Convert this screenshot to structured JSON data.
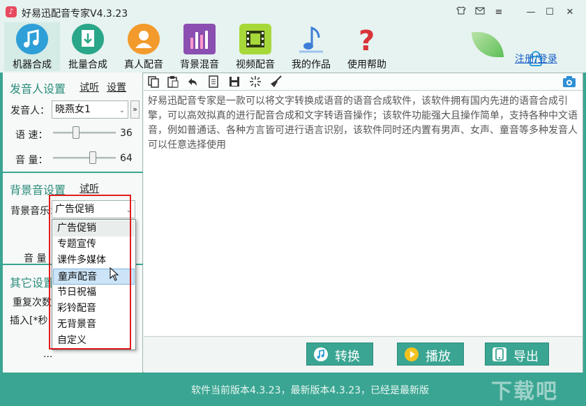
{
  "window": {
    "title": "好易迅配音专家V4.3.23",
    "controls": [
      "shirt-icon",
      "mail-icon",
      "menu-icon",
      "minimize-icon",
      "maximize-icon",
      "close-icon"
    ]
  },
  "toolbar": {
    "items": [
      {
        "label": "机器合成",
        "icon": "music-note-icon",
        "color": "#2f9fd8",
        "active": true
      },
      {
        "label": "批量合成",
        "icon": "download-doc-icon",
        "color": "#2aa688"
      },
      {
        "label": "真人配音",
        "icon": "person-icon",
        "color": "#f39a2c"
      },
      {
        "label": "背景混音",
        "icon": "equalizer-icon",
        "color": "#8a4fb0"
      },
      {
        "label": "视频配音",
        "icon": "film-icon",
        "color": "#a7d83a"
      },
      {
        "label": "我的作品",
        "icon": "music-note-blue-icon",
        "color": "#3d7fd6"
      },
      {
        "label": "使用帮助",
        "icon": "question-icon",
        "color": "#d9333a"
      }
    ],
    "register_label": "注册/登录"
  },
  "speaker_settings": {
    "title": "发音人设置",
    "listen_label": "试听",
    "settings_label": "设置",
    "speaker_label": "发音人：",
    "speaker_value": "晓燕女1",
    "speed_label": "语 速：",
    "speed_value": "36",
    "speed_fraction": 0.36,
    "volume_label": "音 量：",
    "volume_value": "64",
    "volume_fraction": 0.64
  },
  "bg_settings": {
    "title": "背景音设置",
    "listen_label": "试听",
    "music_label": "背景音乐：",
    "music_value": "广告促销",
    "volume_label": "音 量",
    "options": [
      "广告促销",
      "专题宣传",
      "课件多媒体",
      "童声配音",
      "节日祝福",
      "彩铃配音",
      "无背景音",
      "自定义"
    ],
    "hovered_option": "童声配音"
  },
  "other_settings": {
    "title": "其它设置",
    "repeat_label": "重复次数",
    "insert_label": "插入[*秒",
    "ellipsis": "..."
  },
  "editor": {
    "text": "好易迅配音专家是一款可以将文字转换成语音的语音合成软件，该软件拥有国内先进的语音合成引擎，可以高效拟真的进行配音合成和文字转语音操作；该软件功能强大且操作简单，支持各种中文语音，例如普通话、各种方言皆可进行语言识别，该软件同时还内置有男声、女声、童音等多种发音人可以任意选择使用"
  },
  "actions": {
    "convert_label": "转换",
    "play_label": "播放",
    "export_label": "导出"
  },
  "status": {
    "text": "软件当前版本4.3.23，最新版本4.3.23，已经是最新版"
  },
  "colors": {
    "accent": "#3aa592",
    "highlight_box": "#e21c1c"
  }
}
